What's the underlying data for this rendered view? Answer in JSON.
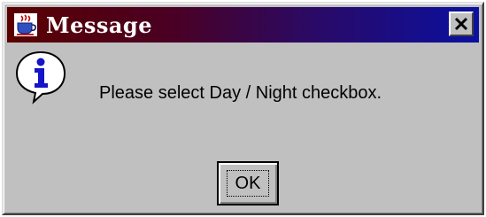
{
  "window": {
    "title": "Message",
    "title_icon": "java-cup-icon",
    "close_icon": "close-icon"
  },
  "content": {
    "icon": "information-icon",
    "message": "Please select Day / Night checkbox."
  },
  "buttons": {
    "ok_label": "OK"
  },
  "colors": {
    "dialog_bg": "#c0c0c0",
    "titlebar_start": "#5a0000",
    "titlebar_end": "#0a10a0",
    "info_blue": "#1414c8"
  }
}
